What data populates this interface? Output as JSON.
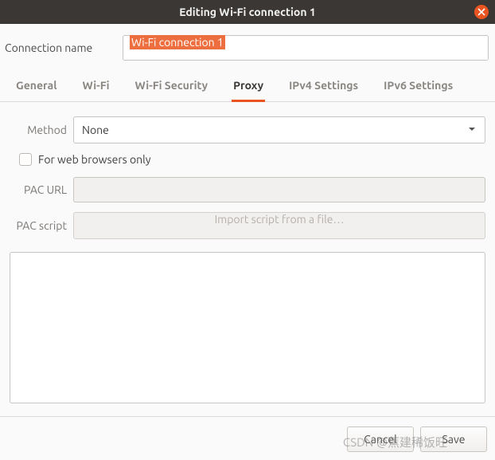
{
  "window": {
    "title": "Editing Wi-Fi connection 1"
  },
  "connection_name": {
    "label": "Connection name",
    "value": "Wi-Fi connection 1"
  },
  "tabs": [
    {
      "label": "General"
    },
    {
      "label": "Wi-Fi"
    },
    {
      "label": "Wi-Fi Security"
    },
    {
      "label": "Proxy",
      "active": true
    },
    {
      "label": "IPv4 Settings"
    },
    {
      "label": "IPv6 Settings"
    }
  ],
  "proxy": {
    "method_label": "Method",
    "method_value": "None",
    "web_only_label": "For web browsers only",
    "web_only_checked": false,
    "pac_url_label": "PAC URL",
    "pac_url_value": "",
    "pac_script_label": "PAC script",
    "import_button": "Import script from a file…"
  },
  "footer": {
    "cancel": "Cancel",
    "save": "Save"
  },
  "watermark": "CSDN @蕉建稀饭旺"
}
